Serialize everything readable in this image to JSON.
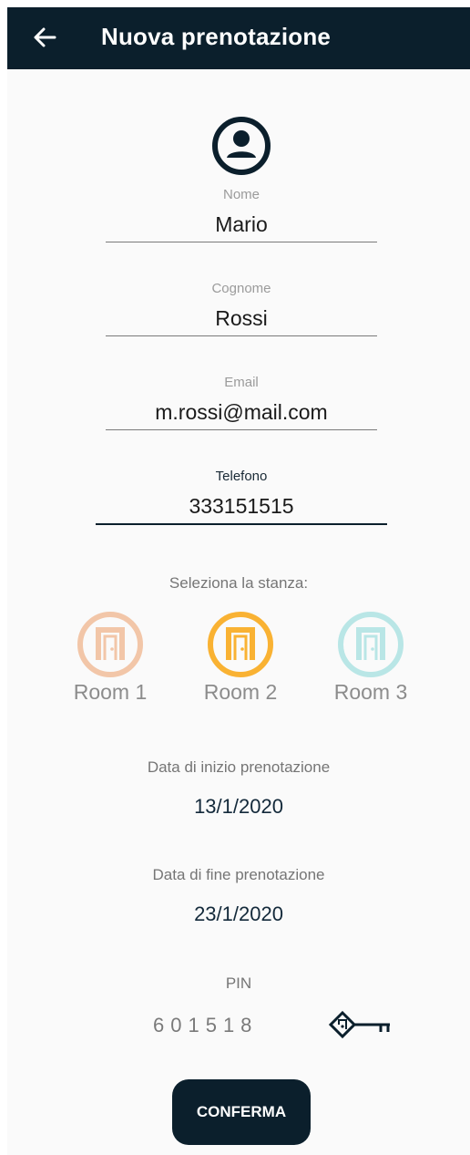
{
  "appbar": {
    "title": "Nuova prenotazione",
    "back_icon": "arrow-left-icon"
  },
  "avatar": {
    "icon": "account-circle-icon"
  },
  "form": {
    "nome": {
      "label": "Nome",
      "value": "Mario"
    },
    "cognome": {
      "label": "Cognome",
      "value": "Rossi"
    },
    "email": {
      "label": "Email",
      "value": "m.rossi@mail.com"
    },
    "telefono": {
      "label": "Telefono",
      "value": "333151515"
    }
  },
  "rooms": {
    "prompt": "Seleziona la stanza:",
    "items": [
      {
        "label": "Room 1",
        "color": "#f2c6a8",
        "selected": false
      },
      {
        "label": "Room 2",
        "color": "#f9b233",
        "selected": true
      },
      {
        "label": "Room 3",
        "color": "#b9e6e6",
        "selected": false
      }
    ]
  },
  "dates": {
    "start_label": "Data di inizio prenotazione",
    "start_value": "13/1/2020",
    "end_label": "Data di fine prenotazione",
    "end_value": "23/1/2020"
  },
  "pin": {
    "label": "PIN",
    "value": "601518",
    "icon": "key-icon"
  },
  "confirm_button": {
    "label": "CONFERMA"
  },
  "colors": {
    "primary_dark": "#0b1f2c",
    "background": "#fafafa"
  }
}
